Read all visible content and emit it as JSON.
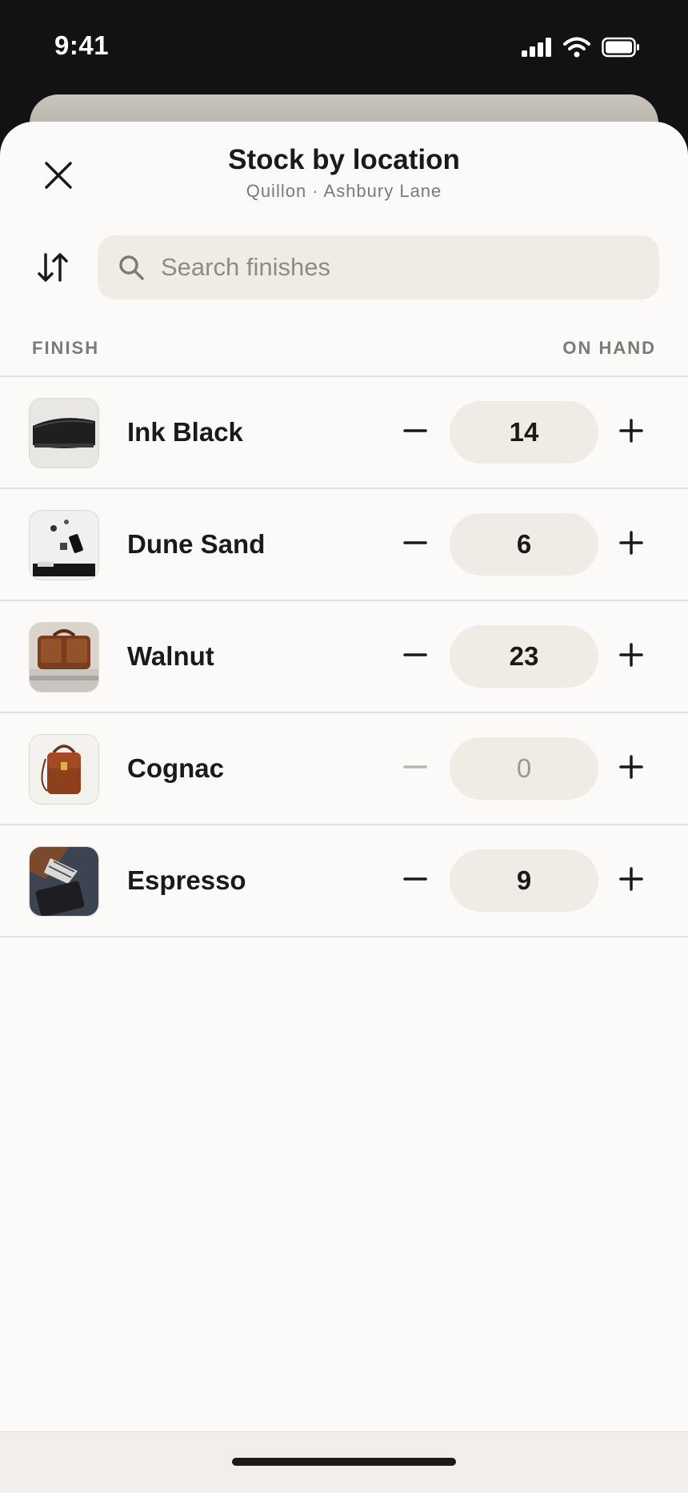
{
  "status_bar": {
    "time": "9:41",
    "icons": [
      "cellular-signal-icon",
      "wifi-icon",
      "battery-icon"
    ]
  },
  "sheet": {
    "title": "Stock by location",
    "subtitle": "Quillon · Ashbury Lane",
    "close_icon": "close-icon",
    "sort_icon": "sort-arrows-icon"
  },
  "search": {
    "placeholder": "Search finishes",
    "value": "",
    "icon": "search-icon"
  },
  "columns": {
    "finish": "FINISH",
    "on_hand": "ON HAND"
  },
  "items": [
    {
      "name": "Ink Black",
      "quantity": "14",
      "decrement_enabled": true
    },
    {
      "name": "Dune Sand",
      "quantity": "6",
      "decrement_enabled": true
    },
    {
      "name": "Walnut",
      "quantity": "23",
      "decrement_enabled": true
    },
    {
      "name": "Cognac",
      "quantity": "0",
      "decrement_enabled": false
    },
    {
      "name": "Espresso",
      "quantity": "9",
      "decrement_enabled": true
    }
  ],
  "colors": {
    "sheet_background": "#fbfaf8",
    "pill_background": "#efece6",
    "text_primary": "#1b1a18",
    "text_muted": "#7c7a76",
    "disabled": "#b9b6b0"
  }
}
